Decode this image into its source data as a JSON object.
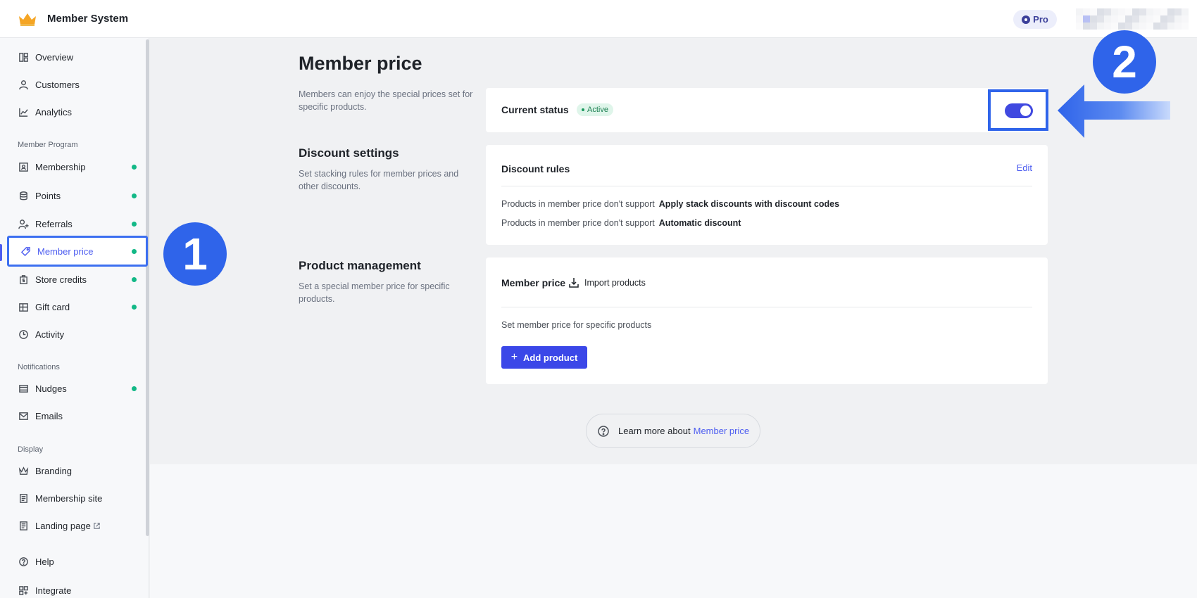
{
  "app": {
    "title": "Member System",
    "plan_badge": "Pro"
  },
  "sidebar": {
    "items": [
      {
        "label": "Overview"
      },
      {
        "label": "Customers"
      },
      {
        "label": "Analytics"
      },
      {
        "label": "Membership"
      },
      {
        "label": "Points"
      },
      {
        "label": "Referrals"
      },
      {
        "label": "Member price"
      },
      {
        "label": "Store credits"
      },
      {
        "label": "Gift card"
      },
      {
        "label": "Activity"
      },
      {
        "label": "Nudges"
      },
      {
        "label": "Emails"
      },
      {
        "label": "Branding"
      },
      {
        "label": "Membership site"
      },
      {
        "label": "Landing page"
      },
      {
        "label": "Help"
      },
      {
        "label": "Integrate"
      }
    ],
    "sections": {
      "member_program": "Member Program",
      "notifications": "Notifications",
      "display": "Display"
    }
  },
  "main": {
    "title": "Member price",
    "intro": "Members can enjoy the special prices set for specific products.",
    "status": {
      "label": "Current status",
      "badge": "Active",
      "enabled": true
    },
    "discount": {
      "title": "Discount settings",
      "desc": "Set stacking rules for member prices and other discounts.",
      "card_title": "Discount rules",
      "edit": "Edit",
      "rules": [
        {
          "prefix": "Products in member price don't support",
          "value": "Apply stack discounts with discount codes"
        },
        {
          "prefix": "Products in member price don't support",
          "value": "Automatic discount"
        }
      ]
    },
    "product": {
      "title": "Product management",
      "desc": "Set a special member price for specific products.",
      "card_title": "Member price",
      "import": "Import products",
      "set_desc": "Set member price for specific products",
      "add_button": "Add product"
    },
    "learn_more": {
      "text": "Learn more about",
      "link": "Member price"
    }
  },
  "annotations": {
    "step1": "1",
    "step2": "2"
  },
  "colors": {
    "accent": "#4c5cf0",
    "callout": "#2f64ea",
    "success": "#12b886"
  }
}
